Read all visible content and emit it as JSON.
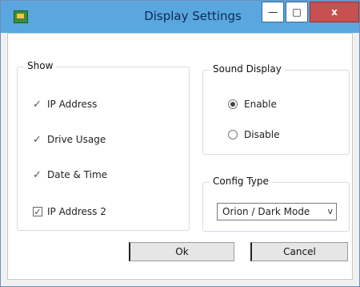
{
  "window": {
    "title": "Display Settings",
    "buttons": {
      "minimize": "—",
      "maximize": "□",
      "close": "x"
    }
  },
  "show": {
    "label": "Show",
    "items": [
      {
        "label": "IP Address",
        "checked": true
      },
      {
        "label": "Drive Usage",
        "checked": true
      },
      {
        "label": "Date & Time",
        "checked": true
      },
      {
        "label": "IP Address 2",
        "checked": true
      }
    ]
  },
  "sound_display": {
    "label": "Sound Display",
    "options": [
      {
        "label": "Enable",
        "selected": true
      },
      {
        "label": "Disable",
        "selected": false
      }
    ]
  },
  "config": {
    "label": "Config Type",
    "selected": "Orion / Dark Mode"
  },
  "actions": {
    "ok": "Ok",
    "cancel": "Cancel"
  }
}
